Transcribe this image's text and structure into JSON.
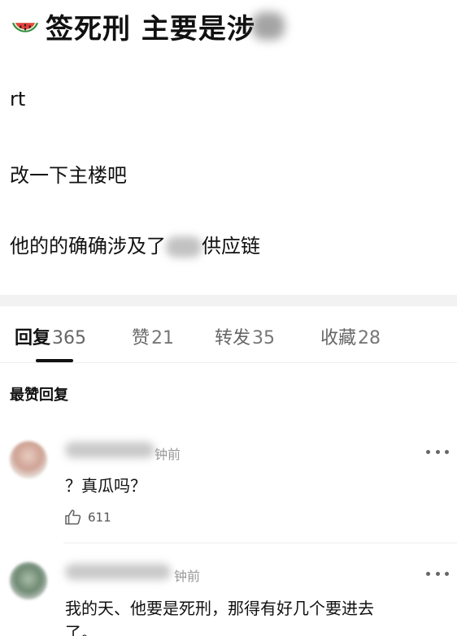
{
  "post": {
    "title_emoji": "watermelon-emoji",
    "title": "签死刑 主要是涉",
    "body": [
      "rt",
      "改一下主楼吧"
    ],
    "line3_before": "他的的确确涉及了",
    "line3_after": "供应链"
  },
  "tabs": [
    {
      "label": "回复",
      "count": "365",
      "active": true
    },
    {
      "label": "赞",
      "count": "21",
      "active": false
    },
    {
      "label": "转发",
      "count": "35",
      "active": false
    },
    {
      "label": "收藏",
      "count": "28",
      "active": false
    }
  ],
  "section_heading": "最赞回复",
  "comments": [
    {
      "time": "钟前",
      "text": "？真瓜吗？",
      "likes": "611"
    },
    {
      "time": "钟前",
      "text_line1": "我的天、他要是死刑，那得有好几个要进去",
      "text_line2": "了。"
    }
  ],
  "icons": {
    "like": "thumbs-up-icon",
    "more": "more-dots-icon"
  },
  "colors": {
    "accent": "#111111",
    "muted": "#999999",
    "band": "#f2f2f2"
  }
}
